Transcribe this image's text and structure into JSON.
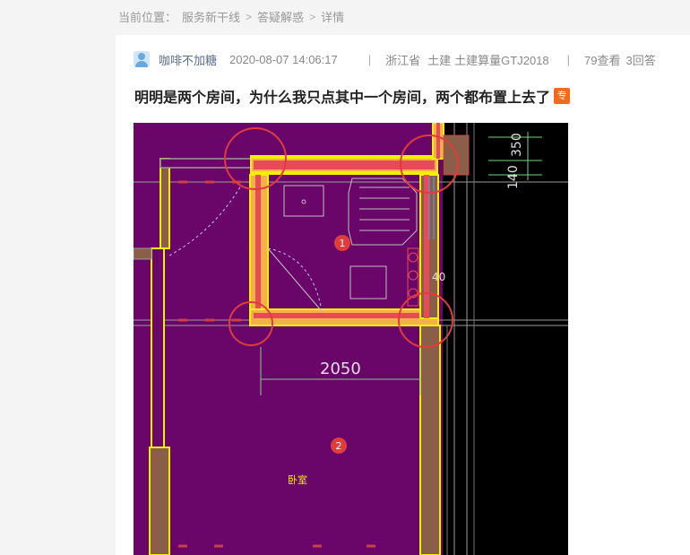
{
  "breadcrumb": {
    "prefix": "当前位置：",
    "items": [
      "服务新干线",
      "答疑解惑",
      "详情"
    ],
    "separator": ">"
  },
  "post": {
    "author": "咖啡不加糖",
    "datetime": "2020-08-07 14:06:17",
    "location": "浙江省",
    "tags": [
      "土建",
      "土建算量GTJ2018"
    ],
    "views": "79查看",
    "answers": "3回答",
    "title": "明明是两个房间，为什么我只点其中一个房间，两个都布置上去了",
    "badge": "专"
  },
  "figure": {
    "dimensions": [
      "350",
      "140",
      "40",
      "2050"
    ],
    "room_markers": [
      "1",
      "2"
    ],
    "room_label": "卧室",
    "colors": {
      "background": "#000000",
      "floor": "#6a0569",
      "wall_outline": "#f2f200",
      "wall_fill": "#8b5e4a",
      "selected_wall": "#e84a5a",
      "highlight_wall": "#f6b04a",
      "circle": "#e03c3c"
    }
  }
}
